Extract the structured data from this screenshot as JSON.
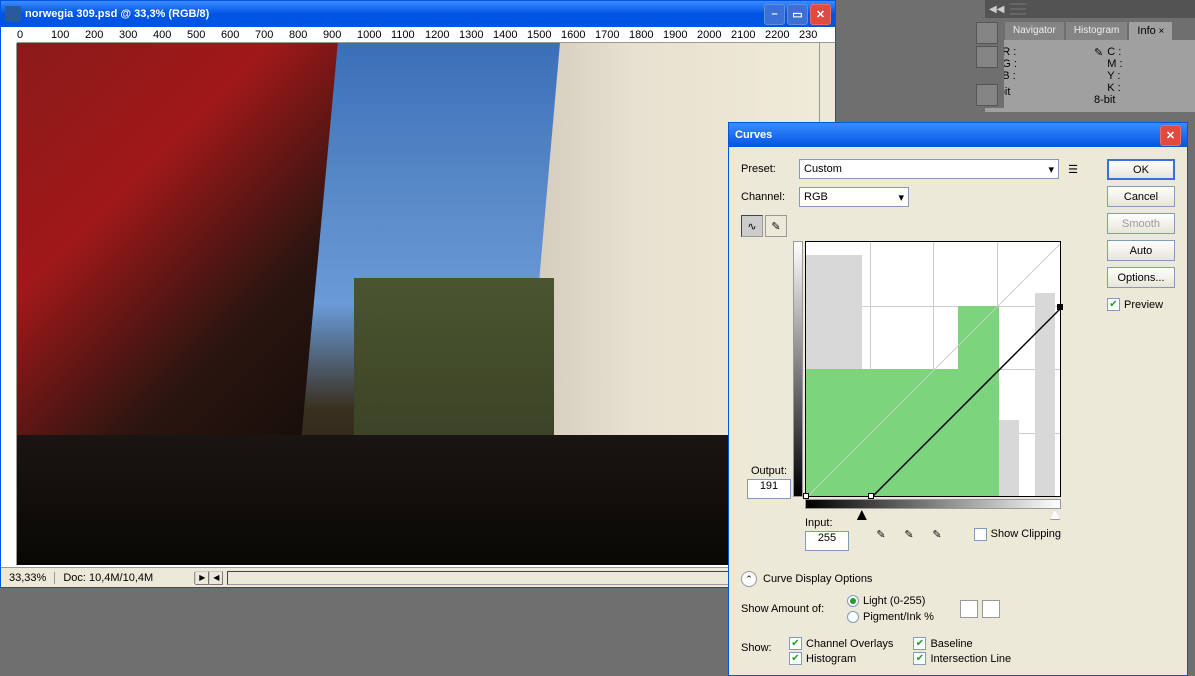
{
  "document": {
    "title": "norwegia 309.psd @ 33,3% (RGB/8)",
    "zoom": "33,33%",
    "doc_info": "Doc: 10,4M/10,4M",
    "ruler_marks": [
      "0",
      "100",
      "200",
      "300",
      "400",
      "500",
      "600",
      "700",
      "800",
      "900",
      "1000",
      "1100",
      "1200",
      "1300",
      "1400",
      "1500",
      "1600",
      "1700",
      "1800",
      "1900",
      "2000",
      "2100",
      "2200",
      "230"
    ]
  },
  "info_panel": {
    "tabs": [
      "Navigator",
      "Histogram",
      "Info"
    ],
    "active_tab": "Info",
    "rgb": {
      "r_label": "R :",
      "g_label": "G :",
      "b_label": "B :"
    },
    "cmyk": {
      "c_label": "C :",
      "m_label": "M :",
      "y_label": "Y :",
      "k_label": "K :"
    },
    "bit1": "8-bit",
    "bit2": "8-bit"
  },
  "curves": {
    "title": "Curves",
    "preset_label": "Preset:",
    "preset_value": "Custom",
    "channel_label": "Channel:",
    "channel_value": "RGB",
    "output_label": "Output:",
    "output_value": "191",
    "input_label": "Input:",
    "input_value": "255",
    "show_clipping": "Show Clipping",
    "curve_display": "Curve Display Options",
    "show_amount": "Show Amount of:",
    "light_label": "Light  (0-255)",
    "pigment_label": "Pigment/Ink %",
    "show_label": "Show:",
    "channel_overlays": "Channel Overlays",
    "baseline": "Baseline",
    "histogram_label": "Histogram",
    "intersection": "Intersection Line",
    "buttons": {
      "ok": "OK",
      "cancel": "Cancel",
      "smooth": "Smooth",
      "auto": "Auto",
      "options": "Options...",
      "preview": "Preview"
    }
  },
  "chart_data": {
    "type": "line",
    "title": "Curves",
    "xlabel": "Input",
    "ylabel": "Output",
    "xlim": [
      0,
      255
    ],
    "ylim": [
      0,
      255
    ],
    "series": [
      {
        "name": "RGB",
        "points": [
          {
            "x": 0,
            "y": 0
          },
          {
            "x": 65,
            "y": 0
          },
          {
            "x": 255,
            "y": 191
          }
        ]
      }
    ],
    "histogram_overlay": true,
    "green_highlight_region": {
      "x": [
        0,
        194
      ],
      "y": [
        0,
        130
      ]
    },
    "selected_point": {
      "x": 255,
      "y": 191
    }
  }
}
